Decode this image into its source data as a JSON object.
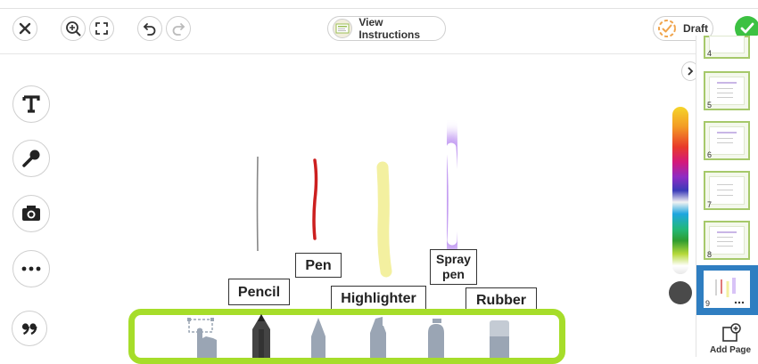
{
  "topbar": {
    "view_instructions_label": "View Instructions",
    "draft_label": "Draft"
  },
  "icons": {
    "close": "close-icon",
    "zoom": "zoom-in-icon",
    "fullscreen": "fullscreen-icon",
    "undo": "undo-icon",
    "redo": "redo-icon",
    "check": "check-icon"
  },
  "canvas": {
    "labels": {
      "pencil": "Pencil",
      "pen": "Pen",
      "highlighter": "Highlighter",
      "spray_pen": "Spray pen",
      "rubber": "Rubber"
    }
  },
  "tools": [
    "text-tool",
    "microphone-tool",
    "camera-tool",
    "more-tool",
    "quote-tool"
  ],
  "sidebar": {
    "pages": [
      {
        "number": "4"
      },
      {
        "number": "5"
      },
      {
        "number": "6"
      },
      {
        "number": "7"
      },
      {
        "number": "8"
      },
      {
        "number": "9",
        "selected": true
      }
    ],
    "add_page_label": "Add Page"
  },
  "colors": {
    "accent_green": "#a6dd2a",
    "check_green": "#3cc142",
    "selected_page_blue": "#2f7ec1",
    "pen_red": "#cc1f1f",
    "highlighter_yellow": "#f3f0a0",
    "spray_purple": "#b98cf0"
  }
}
